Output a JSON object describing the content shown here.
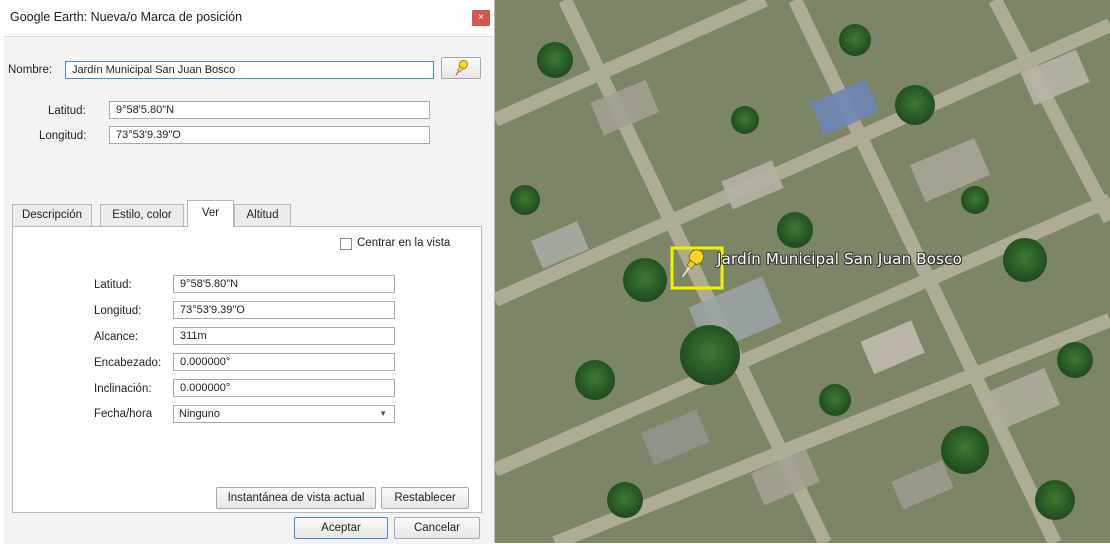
{
  "window": {
    "title": "Google Earth: Nueva/o Marca de posición",
    "close_label": "×"
  },
  "form": {
    "name_label": "Nombre:",
    "name_value": "Jardín Municipal San Juan Bosco",
    "lat_label": "Latitud:",
    "lat_value": "9°58'5.80\"N",
    "lon_label": "Longitud:",
    "lon_value": "73°53'9.39\"O"
  },
  "tabs": [
    {
      "label": "Descripción",
      "active": false
    },
    {
      "label": "Estilo, color",
      "active": false
    },
    {
      "label": "Ver",
      "active": true
    },
    {
      "label": "Altitud",
      "active": false
    }
  ],
  "view": {
    "center_label": "Centrar en la vista",
    "center_checked": false,
    "fields": [
      {
        "label": "Latitud:",
        "value": "9°58'5.80\"N"
      },
      {
        "label": "Longitud:",
        "value": "73°53'9.39\"O"
      },
      {
        "label": "Alcance:",
        "value": "311m"
      },
      {
        "label": "Encabezado:",
        "value": "0.000000°"
      },
      {
        "label": "Inclinación:",
        "value": "0.000000°"
      }
    ],
    "date_label": "Fecha/hora",
    "date_value": "Ninguno",
    "snapshot_label": "Instantánea de vista actual",
    "reset_label": "Restablecer"
  },
  "footer": {
    "accept_label": "Aceptar",
    "cancel_label": "Cancelar"
  },
  "map": {
    "placemark_label": "Jardín Municipal San Juan Bosco",
    "icon": "pushpin-icon",
    "highlight_color": "#f2f200"
  }
}
